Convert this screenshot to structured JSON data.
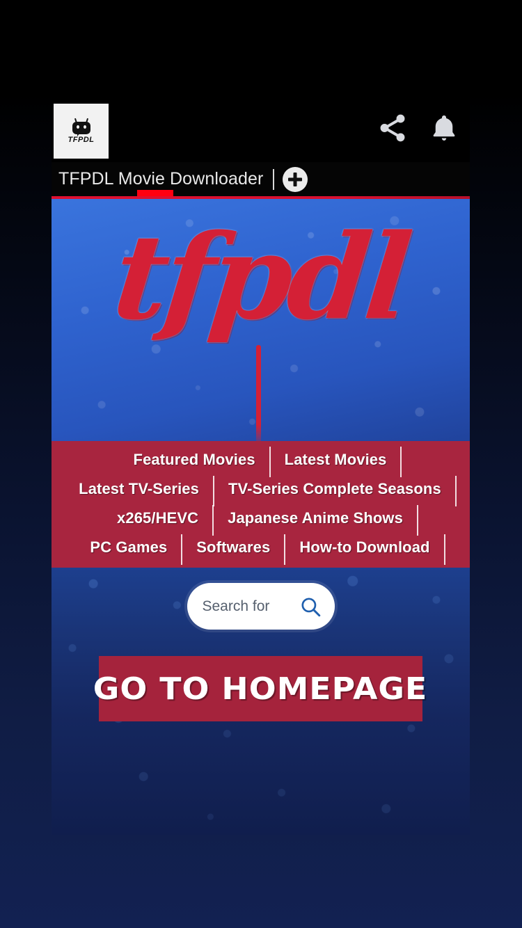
{
  "app": {
    "icon_label": "TFPDL",
    "title": "TFPDL Movie Downloader",
    "logo_text": "tfpdl"
  },
  "topbar": {
    "share_icon": "share-icon",
    "bell_icon": "bell-notification-icon",
    "add_tab_label": "+"
  },
  "nav": {
    "items": [
      {
        "label": "Featured Movies"
      },
      {
        "label": "Latest Movies"
      },
      {
        "label": "Latest TV-Series"
      },
      {
        "label": "TV-Series Complete Seasons"
      },
      {
        "label": "x265/HEVC"
      },
      {
        "label": "Japanese Anime Shows"
      },
      {
        "label": "PC Games"
      },
      {
        "label": "Softwares"
      },
      {
        "label": "How-to Download"
      }
    ]
  },
  "search": {
    "placeholder": "Search for",
    "value": "",
    "icon": "magnifying-glass-icon"
  },
  "cta": {
    "homepage_label": "GO TO HOMEPAGE"
  },
  "colors": {
    "brand_red": "#a8253f",
    "accent_red": "#ff0010",
    "banner_blue": "#2f63cf",
    "panel_blue": "#15275f",
    "logo_red": "#d42036",
    "chrome_black": "#000000"
  }
}
